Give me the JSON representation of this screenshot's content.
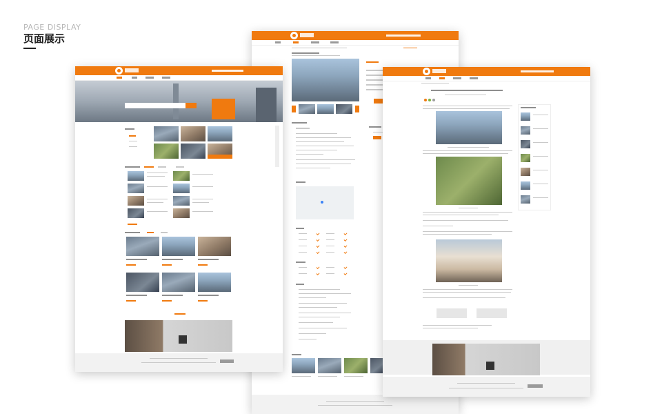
{
  "heading": {
    "en": "PAGE DISPLAY",
    "cn": "页面展示"
  },
  "colors": {
    "accent": "#f07a0f",
    "footer": "#f2f2f2"
  },
  "mockups": [
    {
      "name": "home-page",
      "icon": "logo-icon"
    },
    {
      "name": "property-detail-page",
      "icon": "logo-icon"
    },
    {
      "name": "news-article-page",
      "icon": "logo-icon"
    }
  ]
}
